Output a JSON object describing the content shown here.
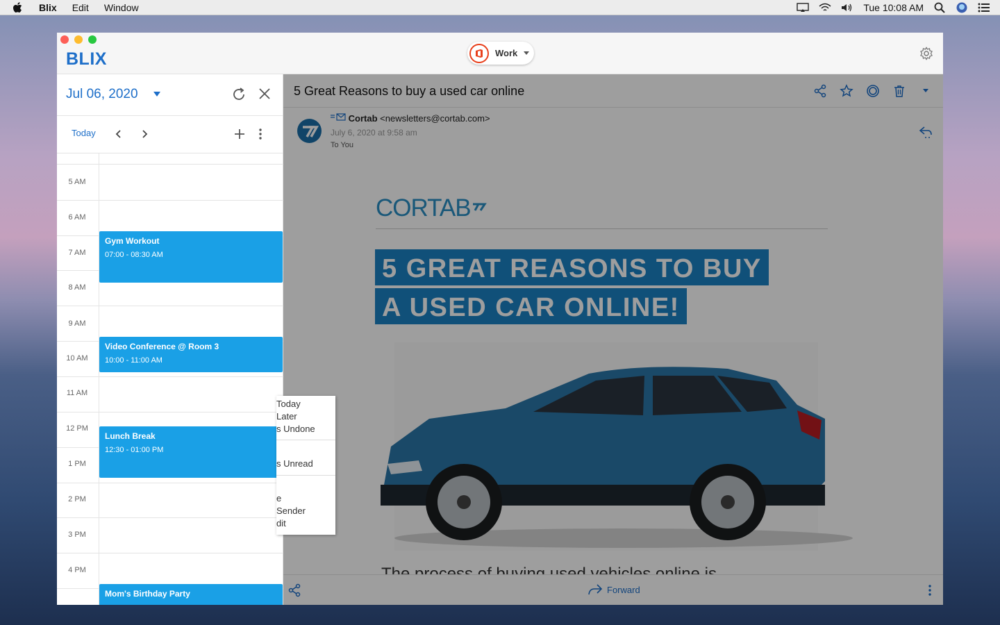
{
  "menubar": {
    "app": "Blix",
    "items": [
      "Edit",
      "Window"
    ],
    "clock": "Tue 10:08 AM"
  },
  "window": {
    "logo": "BLIX",
    "account": "Work"
  },
  "calendar": {
    "date": "Jul 06, 2020",
    "today": "Today",
    "hours": [
      "5 AM",
      "6 AM",
      "7 AM",
      "8 AM",
      "9 AM",
      "10 AM",
      "11 AM",
      "12 PM",
      "1 PM",
      "2 PM",
      "3 PM",
      "4 PM"
    ],
    "events": [
      {
        "title": "Gym Workout",
        "time": "07:00 - 08:30 AM"
      },
      {
        "title": "Video Conference @ Room 3",
        "time": "10:00 - 11:00 AM"
      },
      {
        "title": "Lunch Break",
        "time": "12:30 - 01:00 PM"
      },
      {
        "title": "Mom's Birthday Party",
        "time": ""
      }
    ]
  },
  "email": {
    "subject": "5 Great Reasons to buy a used car online",
    "sender_name": "Cortab",
    "sender_email": "<newsletters@cortab.com>",
    "date": "July 6, 2020 at 9:58 am",
    "to": "To You",
    "brand": "CORTAB",
    "headline_1": "5 GREAT REASONS TO BUY",
    "headline_2": "A USED CAR ONLINE!",
    "lead": "The process of buying used vehicles online is"
  },
  "context_menu": {
    "items": [
      "Today",
      "Later",
      "s Undone",
      "s Unread",
      "e",
      "Sender",
      "dit"
    ]
  },
  "footer": {
    "forward": "Forward"
  },
  "colors": {
    "accent": "#1e6fc9",
    "event": "#1aa0e6",
    "headline_bg": "#1b82c4"
  }
}
